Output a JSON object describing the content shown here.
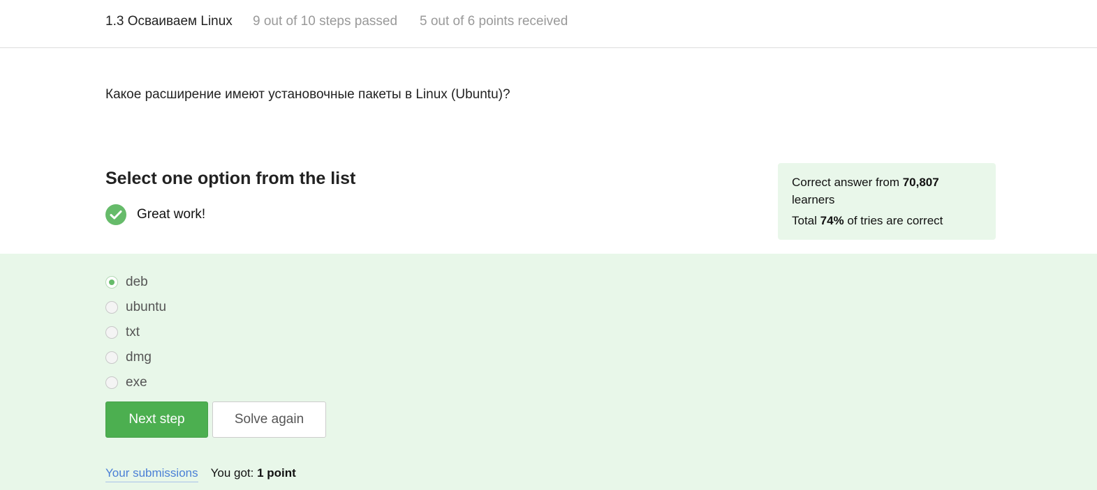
{
  "header": {
    "lesson_title": "1.3 Осваиваем Linux",
    "steps_passed": "9 out of 10 steps passed",
    "points_received": "5 out of 6 points  received"
  },
  "question": {
    "text": "Какое расширение имеют установочные пакеты в Linux (Ubuntu)?"
  },
  "quiz": {
    "prompt": "Select one option from the list",
    "feedback": "Great work!",
    "options": [
      {
        "label": "deb",
        "selected": true
      },
      {
        "label": "ubuntu",
        "selected": false
      },
      {
        "label": "txt",
        "selected": false
      },
      {
        "label": "dmg",
        "selected": false
      },
      {
        "label": "exe",
        "selected": false
      }
    ]
  },
  "stats": {
    "prefix": "Correct answer from ",
    "learners_count": "70,807",
    "learners_suffix": "learners",
    "total_prefix": "Total ",
    "percent_correct": "74%",
    "total_suffix": " of tries are correct"
  },
  "actions": {
    "next_step": "Next step",
    "solve_again": "Solve again"
  },
  "footer": {
    "submissions_link": "Your submissions",
    "result_prefix": "You got: ",
    "result_value": "1 point"
  },
  "colors": {
    "accent_green": "#4caf50",
    "answer_background": "#e8f7e9",
    "stats_background": "#e9f7ea",
    "link_blue": "#4a7fd6"
  },
  "icons": {
    "feedback": "check-circle-icon"
  }
}
